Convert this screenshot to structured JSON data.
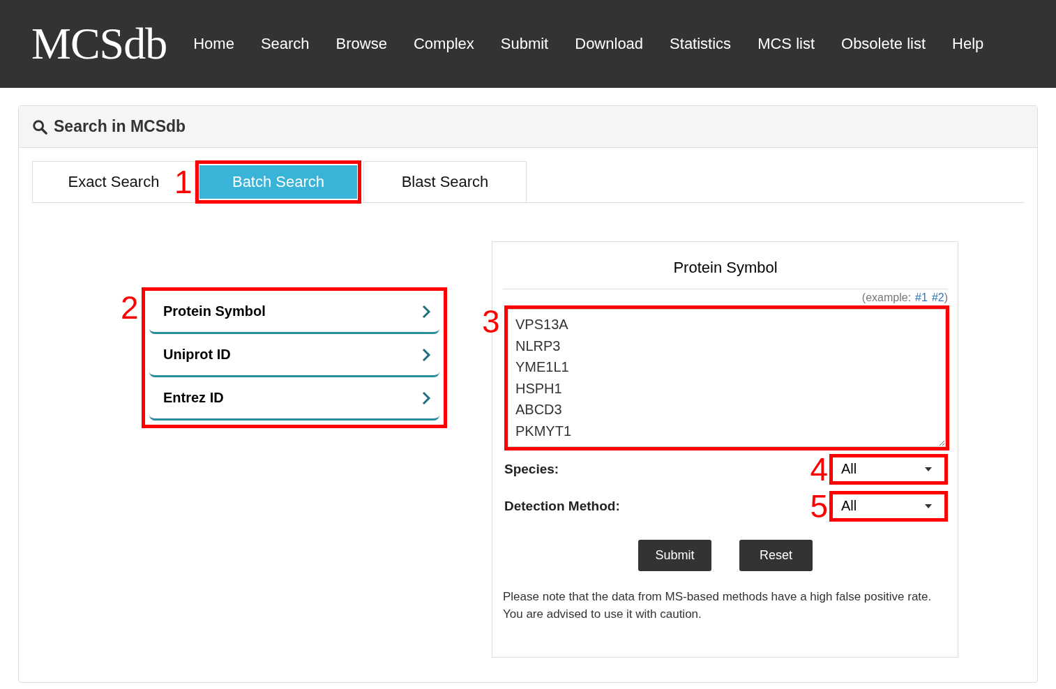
{
  "navbar": {
    "logo": "MCSdb",
    "items": [
      {
        "label": "Home"
      },
      {
        "label": "Search"
      },
      {
        "label": "Browse"
      },
      {
        "label": "Complex"
      },
      {
        "label": "Submit"
      },
      {
        "label": "Download"
      },
      {
        "label": "Statistics"
      },
      {
        "label": "MCS list"
      },
      {
        "label": "Obsolete list"
      },
      {
        "label": "Help"
      }
    ]
  },
  "panel": {
    "title": "Search in MCSdb"
  },
  "tabs": [
    {
      "label": "Exact Search",
      "selected": false
    },
    {
      "label": "Batch Search",
      "selected": true,
      "marker": "1"
    },
    {
      "label": "Blast Search",
      "selected": false
    }
  ],
  "id_types": {
    "marker": "2",
    "items": [
      {
        "label": "Protein Symbol"
      },
      {
        "label": "Uniprot ID"
      },
      {
        "label": "Entrez ID"
      }
    ]
  },
  "form": {
    "title": "Protein Symbol",
    "example_label": "(example:",
    "example_links": [
      "#1",
      "#2"
    ],
    "example_close": ")",
    "query": {
      "marker": "3",
      "value": "VPS13A\nNLRP3\nYME1L1\nHSPH1\nABCD3\nPKMYT1"
    },
    "filters": [
      {
        "label": "Species:",
        "value": "All",
        "marker": "4"
      },
      {
        "label": "Detection Method:",
        "value": "All",
        "marker": "5"
      }
    ],
    "buttons": [
      "Submit",
      "Reset"
    ],
    "note": "Please note that the data from MS-based methods have a high false positive rate. You are advised to use it with caution."
  }
}
